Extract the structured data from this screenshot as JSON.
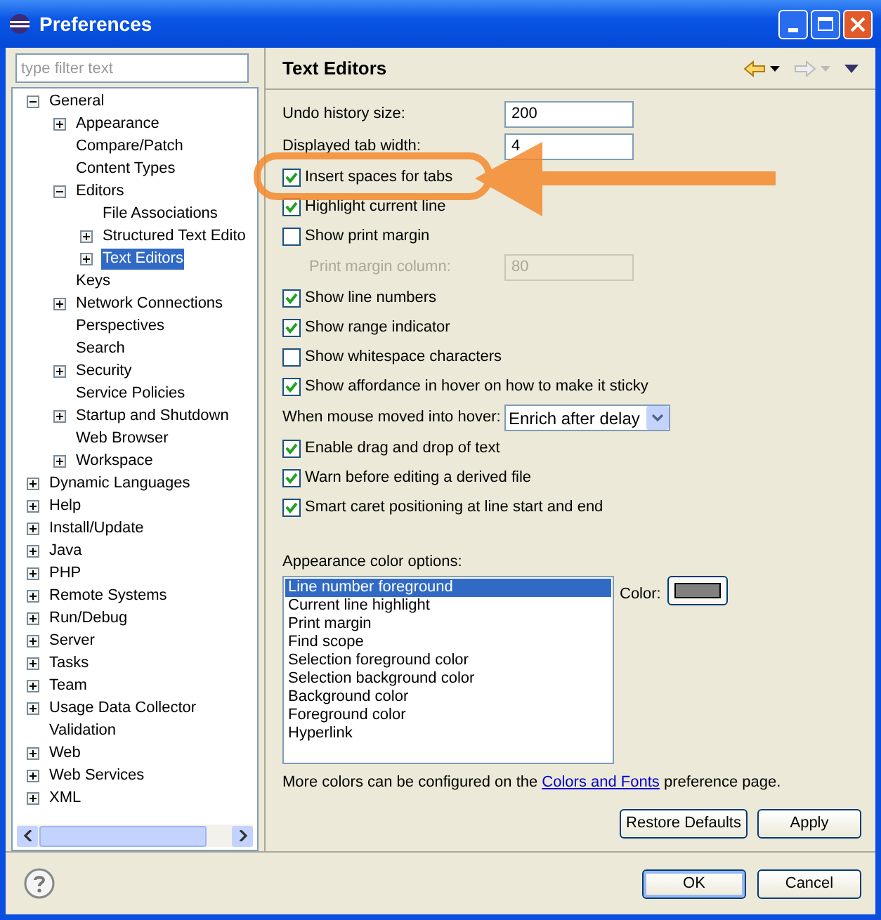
{
  "window": {
    "title": "Preferences"
  },
  "filter": {
    "placeholder": "type filter text"
  },
  "tree": [
    {
      "label": "General",
      "kind": "branch",
      "expanded": true,
      "selected": false,
      "children": [
        {
          "label": "Appearance",
          "kind": "branch",
          "expanded": false,
          "selected": false
        },
        {
          "label": "Compare/Patch",
          "kind": "leaf",
          "selected": false
        },
        {
          "label": "Content Types",
          "kind": "leaf",
          "selected": false
        },
        {
          "label": "Editors",
          "kind": "branch",
          "expanded": true,
          "selected": false,
          "children": [
            {
              "label": "File Associations",
              "kind": "leaf",
              "selected": false
            },
            {
              "label": "Structured Text Edito",
              "kind": "branch",
              "expanded": false,
              "selected": false
            },
            {
              "label": "Text Editors",
              "kind": "branch",
              "expanded": false,
              "selected": true
            }
          ]
        },
        {
          "label": "Keys",
          "kind": "leaf",
          "selected": false
        },
        {
          "label": "Network Connections",
          "kind": "branch",
          "expanded": false,
          "selected": false
        },
        {
          "label": "Perspectives",
          "kind": "leaf",
          "selected": false
        },
        {
          "label": "Search",
          "kind": "leaf",
          "selected": false
        },
        {
          "label": "Security",
          "kind": "branch",
          "expanded": false,
          "selected": false
        },
        {
          "label": "Service Policies",
          "kind": "leaf",
          "selected": false
        },
        {
          "label": "Startup and Shutdown",
          "kind": "branch",
          "expanded": false,
          "selected": false
        },
        {
          "label": "Web Browser",
          "kind": "leaf",
          "selected": false
        },
        {
          "label": "Workspace",
          "kind": "branch",
          "expanded": false,
          "selected": false
        }
      ]
    },
    {
      "label": "Dynamic Languages",
      "kind": "branch",
      "expanded": false,
      "selected": false
    },
    {
      "label": "Help",
      "kind": "branch",
      "expanded": false,
      "selected": false
    },
    {
      "label": "Install/Update",
      "kind": "branch",
      "expanded": false,
      "selected": false
    },
    {
      "label": "Java",
      "kind": "branch",
      "expanded": false,
      "selected": false
    },
    {
      "label": "PHP",
      "kind": "branch",
      "expanded": false,
      "selected": false
    },
    {
      "label": "Remote Systems",
      "kind": "branch",
      "expanded": false,
      "selected": false
    },
    {
      "label": "Run/Debug",
      "kind": "branch",
      "expanded": false,
      "selected": false
    },
    {
      "label": "Server",
      "kind": "branch",
      "expanded": false,
      "selected": false
    },
    {
      "label": "Tasks",
      "kind": "branch",
      "expanded": false,
      "selected": false
    },
    {
      "label": "Team",
      "kind": "branch",
      "expanded": false,
      "selected": false
    },
    {
      "label": "Usage Data Collector",
      "kind": "branch",
      "expanded": false,
      "selected": false
    },
    {
      "label": "Validation",
      "kind": "leaf",
      "selected": false
    },
    {
      "label": "Web",
      "kind": "branch",
      "expanded": false,
      "selected": false
    },
    {
      "label": "Web Services",
      "kind": "branch",
      "expanded": false,
      "selected": false
    },
    {
      "label": "XML",
      "kind": "branch",
      "expanded": false,
      "selected": false
    }
  ],
  "page": {
    "title": "Text Editors"
  },
  "options": [
    {
      "kind": "text_field",
      "label": "Undo history size:",
      "value": "200",
      "disabled": false
    },
    {
      "kind": "text_field",
      "label": "Displayed tab width:",
      "value": "4",
      "disabled": false
    },
    {
      "kind": "checkbox",
      "label": "Insert spaces for tabs",
      "checked": true
    },
    {
      "kind": "checkbox",
      "label": "Highlight current line",
      "checked": true
    },
    {
      "kind": "checkbox",
      "label": "Show print margin",
      "checked": false
    },
    {
      "kind": "text_field",
      "label": "Print margin column:",
      "value": "80",
      "disabled": true
    },
    {
      "kind": "checkbox",
      "label": "Show line numbers",
      "checked": true
    },
    {
      "kind": "checkbox",
      "label": "Show range indicator",
      "checked": true
    },
    {
      "kind": "checkbox",
      "label": "Show whitespace characters",
      "checked": false
    },
    {
      "kind": "checkbox",
      "label": "Show affordance in hover on how to make it sticky",
      "checked": true
    },
    {
      "kind": "dropdown",
      "label": "When mouse moved into hover:",
      "value": "Enrich after delay"
    },
    {
      "kind": "checkbox",
      "label": "Enable drag and drop of text",
      "checked": true
    },
    {
      "kind": "checkbox",
      "label": "Warn before editing a derived file",
      "checked": true
    },
    {
      "kind": "checkbox",
      "label": "Smart caret positioning at line start and end",
      "checked": true
    }
  ],
  "color_options": {
    "label": "Appearance color options:",
    "color_label": "Color:",
    "items": [
      {
        "label": "Line number foreground",
        "selected": true
      },
      {
        "label": "Current line highlight",
        "selected": false
      },
      {
        "label": "Print margin",
        "selected": false
      },
      {
        "label": "Find scope",
        "selected": false
      },
      {
        "label": "Selection foreground color",
        "selected": false
      },
      {
        "label": "Selection background color",
        "selected": false
      },
      {
        "label": "Background color",
        "selected": false
      },
      {
        "label": "Foreground color",
        "selected": false
      },
      {
        "label": "Hyperlink",
        "selected": false
      }
    ]
  },
  "note": {
    "before": "More colors can be configured on the",
    "link": "Colors and Fonts",
    "after": "preference page."
  },
  "page_buttons": [
    "Restore Defaults",
    "Apply"
  ],
  "dialog_buttons": [
    {
      "label": "OK",
      "default": true
    },
    {
      "label": "Cancel",
      "default": false
    }
  ]
}
